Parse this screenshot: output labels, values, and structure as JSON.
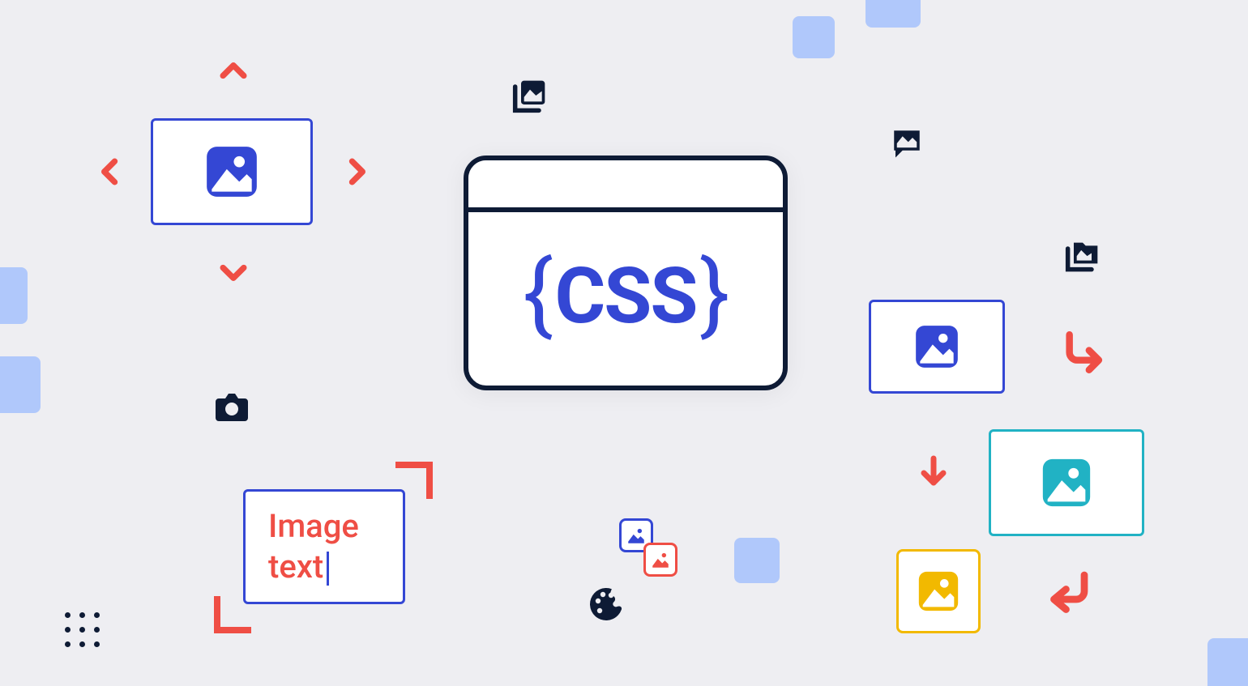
{
  "colors": {
    "bg": "#eeeef2",
    "navy": "#0e1b35",
    "blue": "#3447d4",
    "lightblue": "#b0c8fb",
    "red": "#ef4e45",
    "teal": "#21b2c4",
    "amber": "#f2b900"
  },
  "center_window": {
    "label": "CSS",
    "brace_open": "{",
    "brace_close": "}"
  },
  "text_card": {
    "line1": "Image",
    "line2": "text"
  },
  "icons": {
    "top_left_card": "image-placeholder",
    "chevrons": [
      "up",
      "down",
      "left",
      "right"
    ],
    "gallery_stack": "image-gallery",
    "mms_bubble": "multimedia-message",
    "folder_stack": "multimedia-folder",
    "camera": "camera",
    "palette": "color-palette",
    "small_pair_blue": "image-placeholder",
    "small_pair_red": "image-placeholder",
    "right_blue_card": "image-placeholder",
    "teal_card": "image-placeholder",
    "amber_card": "image-placeholder",
    "arrows": [
      "turn-down-right",
      "down",
      "return-left"
    ],
    "corner_marks": "crop-corners",
    "dots": "drag-handle"
  },
  "decorative_squares": 6
}
